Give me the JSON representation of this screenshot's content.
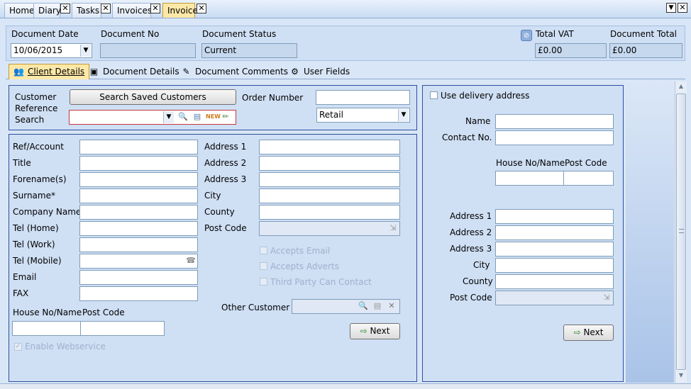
{
  "tabs": [
    {
      "label": "Home"
    },
    {
      "label": "Diary"
    },
    {
      "label": "Tasks"
    },
    {
      "label": "Invoices"
    },
    {
      "label": "Invoice",
      "active": true
    }
  ],
  "header": {
    "doc_date_label": "Document Date",
    "doc_date_value": "10/06/2015",
    "doc_no_label": "Document No",
    "doc_no_value": "",
    "doc_status_label": "Document Status",
    "doc_status_value": "Current",
    "total_vat_label": "Total VAT",
    "total_vat_value": "£0.00",
    "doc_total_label": "Document Total",
    "doc_total_value": "£0.00"
  },
  "subtabs": [
    {
      "label": "Client Details",
      "icon": "people-icon",
      "active": true
    },
    {
      "label": "Document Details",
      "icon": "box-icon"
    },
    {
      "label": "Document Comments",
      "icon": "notepad-icon"
    },
    {
      "label": "User Fields",
      "icon": "user-fields-icon"
    }
  ],
  "search": {
    "cust_ref_label": "Customer Reference Search",
    "search_button": "Search Saved Customers",
    "order_number_label": "Order Number",
    "order_number_value": "",
    "sales_type_value": "Retail"
  },
  "client": {
    "left_labels": [
      "Ref/Account",
      "Title",
      "Forename(s)",
      "Surname*",
      "Company Name",
      "Tel (Home)",
      "Tel (Work)",
      "Tel (Mobile)",
      "Email",
      "FAX"
    ],
    "address_labels": [
      "Address 1",
      "Address 2",
      "Address 3",
      "City",
      "County",
      "Post Code"
    ],
    "house_label": "House No/Name",
    "postcode_label": "Post Code",
    "accepts_email": "Accepts Email",
    "accepts_adverts": "Accepts Adverts",
    "third_party": "Third Party Can Contact",
    "other_customer_label": "Other Customer",
    "next_button": "Next",
    "enable_webservice": "Enable Webservice"
  },
  "delivery": {
    "use_delivery_label": "Use delivery address",
    "name_label": "Name",
    "contact_label": "Contact No.",
    "house_label": "House No/Name",
    "postcode_label": "Post Code",
    "address_labels": [
      "Address 1",
      "Address 2",
      "Address 3",
      "City",
      "County",
      "Post Code"
    ],
    "next_button": "Next"
  }
}
